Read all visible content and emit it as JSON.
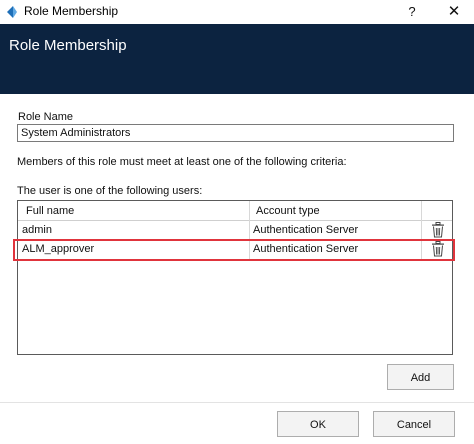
{
  "window": {
    "title": "Role Membership",
    "help": "?",
    "close": "✕"
  },
  "header": {
    "title": "Role Membership"
  },
  "role_name": {
    "label": "Role Name",
    "value": "System Administrators"
  },
  "criteria_text": "Members of this role must meet at least one of the following criteria:",
  "users_label": "The user is one of the following users:",
  "table": {
    "columns": [
      "Full name",
      "Account type"
    ],
    "rows": [
      {
        "full_name": "admin",
        "account_type": "Authentication Server"
      },
      {
        "full_name": "ALM_approver",
        "account_type": "Authentication Server"
      }
    ]
  },
  "buttons": {
    "add": "Add",
    "ok": "OK",
    "cancel": "Cancel"
  },
  "colors": {
    "header_bg": "#0c2340",
    "highlight": "#e0343c"
  }
}
